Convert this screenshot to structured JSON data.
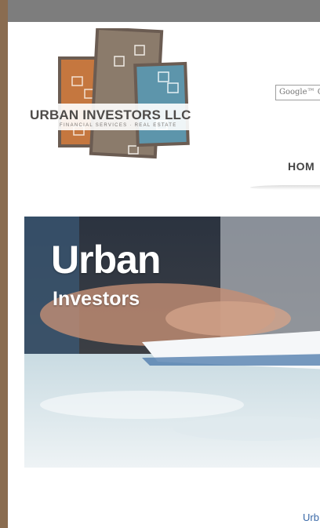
{
  "logo": {
    "company_name": "URBAN INVESTORS LLC",
    "tagline": "FINANCIAL SERVICES · REAL ESTATE",
    "colors": {
      "orange": "#c5773f",
      "brown": "#8b7b6b",
      "blue": "#5d95ab",
      "outline": "#6b5c52"
    }
  },
  "search": {
    "placeholder": "Google™ C"
  },
  "nav": {
    "home_label": "HOM"
  },
  "hero": {
    "title": "Urban",
    "subtitle": "Investors"
  },
  "footer": {
    "link_text": "Urb"
  },
  "theme": {
    "left_bar": "#8a6c50",
    "top_bar": "#7d7d7d",
    "link": "#3b6aa8"
  }
}
